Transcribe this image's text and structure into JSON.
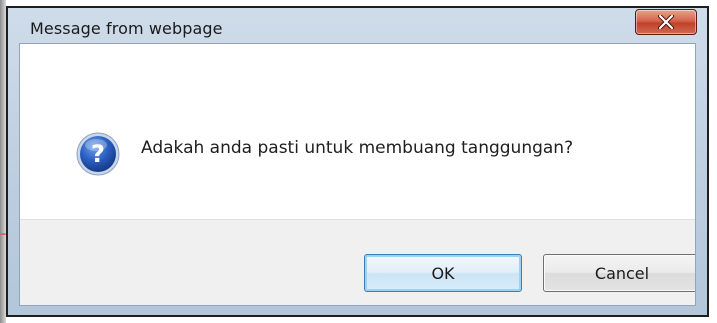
{
  "dialog": {
    "title": "Message from webpage",
    "message": "Adakah anda pasti untuk membuang tanggungan?",
    "icon": "question-icon",
    "buttons": {
      "ok_label": "OK",
      "cancel_label": "Cancel"
    }
  },
  "titlebar": {
    "close_icon": "close-icon",
    "close_color": "#c9472f"
  },
  "colors": {
    "frame": "#bccddf",
    "button_area": "#f0f0f0",
    "ok_border": "#3c7fb1",
    "arrow": "#e03a1a"
  }
}
